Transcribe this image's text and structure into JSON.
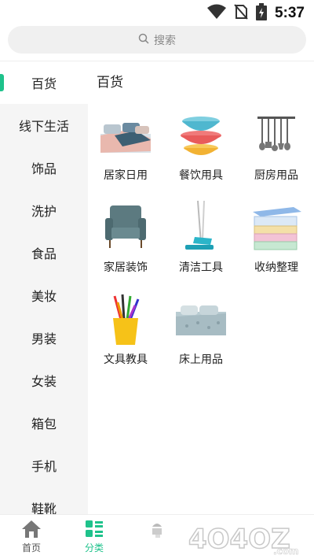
{
  "status_bar": {
    "time": "5:37"
  },
  "search": {
    "placeholder": "搜索"
  },
  "sidebar": {
    "items": [
      {
        "label": "百货"
      },
      {
        "label": "线下生活"
      },
      {
        "label": "饰品"
      },
      {
        "label": "洗护"
      },
      {
        "label": "食品"
      },
      {
        "label": "美妆"
      },
      {
        "label": "男装"
      },
      {
        "label": "女装"
      },
      {
        "label": "箱包"
      },
      {
        "label": "手机"
      },
      {
        "label": "鞋靴"
      }
    ]
  },
  "content": {
    "title": "百货",
    "categories": [
      {
        "label": "居家日用",
        "icon": "bedding-image"
      },
      {
        "label": "餐饮用具",
        "icon": "bowls-image"
      },
      {
        "label": "厨房用品",
        "icon": "utensils-image"
      },
      {
        "label": "家居装饰",
        "icon": "armchair-image"
      },
      {
        "label": "清洁工具",
        "icon": "mop-image"
      },
      {
        "label": "收纳整理",
        "icon": "storage-box-image"
      },
      {
        "label": "文具教具",
        "icon": "pencil-cup-image"
      },
      {
        "label": "床上用品",
        "icon": "bed-image"
      }
    ]
  },
  "tabbar": {
    "tabs": [
      {
        "label": "首页",
        "icon": "home-icon"
      },
      {
        "label": "分类",
        "icon": "category-icon"
      },
      {
        "label": "",
        "icon": "placeholder-icon"
      }
    ]
  },
  "watermark": {
    "text": "4O4OZ.com"
  },
  "colors": {
    "accent": "#1ec28b",
    "sidebar_bg": "#f5f5f5",
    "search_bg": "#f0f0f0"
  }
}
